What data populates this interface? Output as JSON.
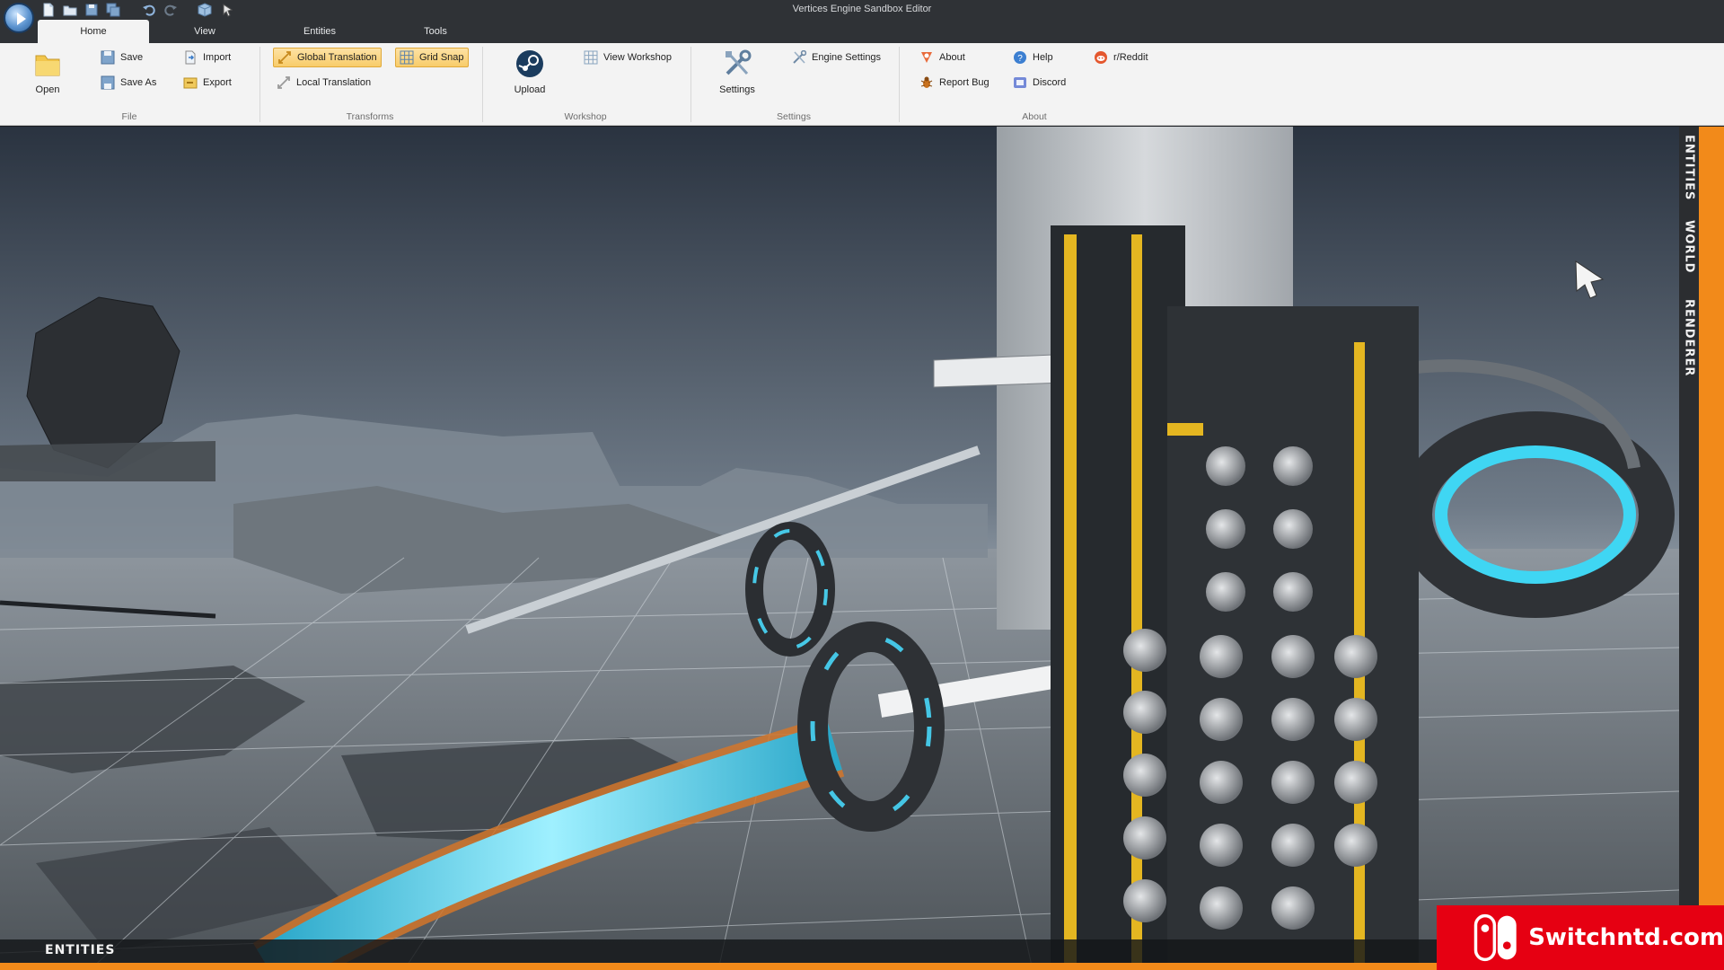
{
  "window": {
    "title": "Vertices Engine Sandbox Editor"
  },
  "quick_access": [
    "new-file-icon",
    "open-folder-icon",
    "save-icon",
    "save-all-icon",
    "undo-icon",
    "redo-icon",
    "package-icon",
    "cursor-icon"
  ],
  "tabs": [
    {
      "label": "Home",
      "active": true
    },
    {
      "label": "View"
    },
    {
      "label": "Entities"
    },
    {
      "label": "Tools"
    }
  ],
  "ribbon": {
    "file": {
      "label": "File",
      "open": "Open",
      "save": "Save",
      "save_as": "Save As",
      "import": "Import",
      "export": "Export"
    },
    "transforms": {
      "label": "Transforms",
      "global_translation": "Global Translation",
      "local_translation": "Local Translation",
      "grid_snap": "Grid Snap"
    },
    "workshop": {
      "label": "Workshop",
      "upload": "Upload",
      "view_workshop": "View Workshop"
    },
    "settings": {
      "label": "Settings",
      "settings": "Settings",
      "engine_settings": "Engine Settings"
    },
    "about": {
      "label": "About",
      "about": "About",
      "report_bug": "Report Bug",
      "help": "Help",
      "discord": "Discord",
      "reddit": "r/Reddit"
    }
  },
  "dock_tabs": [
    "ENTITIES",
    "WORLD",
    "RENDERER"
  ],
  "bottom_tab": "ENTITIES",
  "watermark": "Switchntd.com",
  "colors": {
    "accent": "#f28a1a",
    "ribbon_bg": "#f3f3f3",
    "titlebar": "#2f3236",
    "toggle": "#f8cc6a",
    "watermark": "#e60012"
  }
}
